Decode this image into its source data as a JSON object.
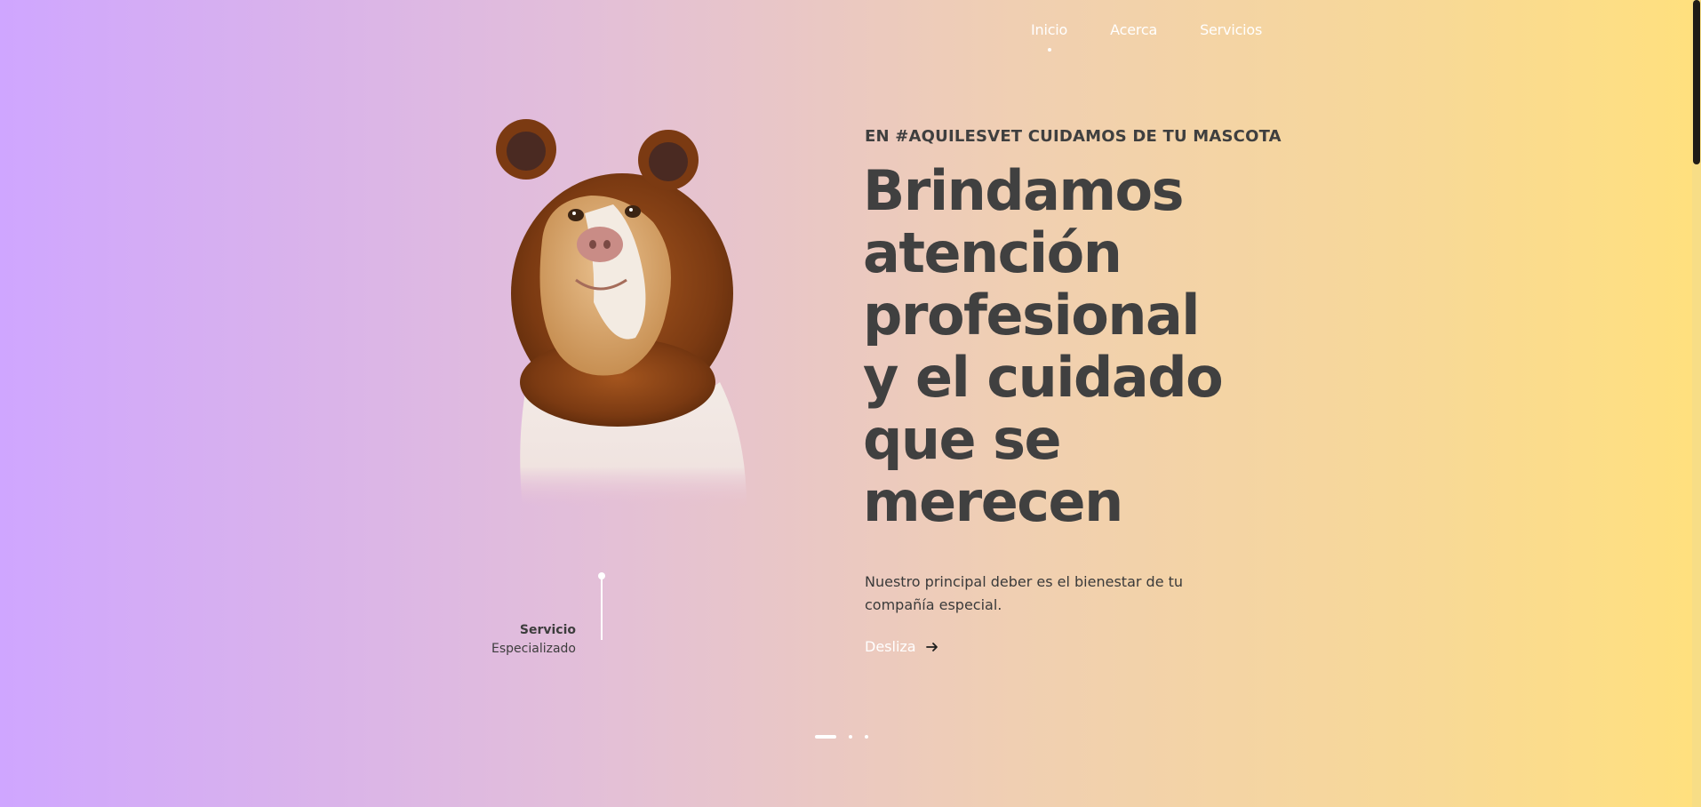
{
  "nav": {
    "items": [
      {
        "label": "Inicio",
        "active": true
      },
      {
        "label": "Acerca",
        "active": false
      },
      {
        "label": "Servicios",
        "active": false
      }
    ]
  },
  "hero": {
    "eyebrow": "EN #AQUILESVET CUIDAMOS DE TU MASCOTA",
    "headline_lines": [
      "Brindamos",
      "atención",
      "profesional",
      "y el cuidado",
      "que se",
      "merecen"
    ],
    "description": "Nuestro principal deber es el bienestar de tu compañía especial.",
    "cta_label": "Desliza",
    "cta_icon": "arrow-right-icon"
  },
  "service": {
    "title": "Servicio",
    "subtitle": "Especializado"
  },
  "pager": {
    "count": 3,
    "active_index": 0
  },
  "colors": {
    "gradient_start": "#cfa6ff",
    "gradient_end": "#ffe07e",
    "text_dark": "#404040",
    "white": "#ffffff"
  }
}
